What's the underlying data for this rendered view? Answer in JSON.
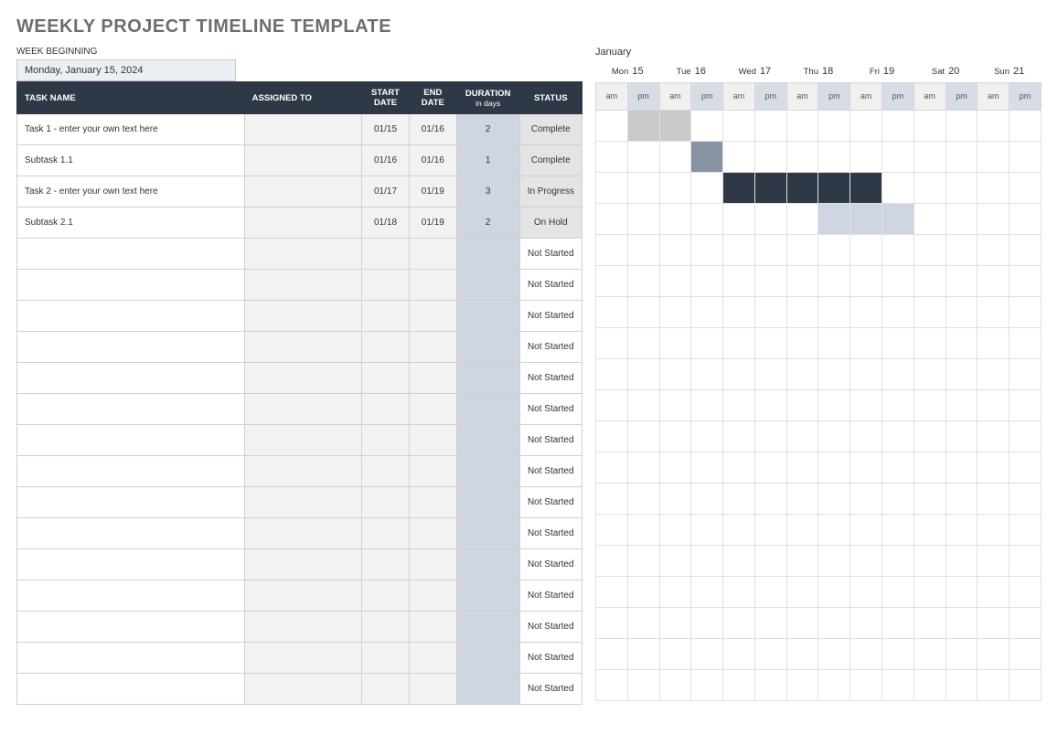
{
  "title": "WEEKLY PROJECT TIMELINE TEMPLATE",
  "week_beginning_label": "WEEK BEGINNING",
  "week_beginning_value": "Monday, January 15, 2024",
  "month": "January",
  "days": [
    {
      "name": "Mon",
      "num": "15"
    },
    {
      "name": "Tue",
      "num": "16"
    },
    {
      "name": "Wed",
      "num": "17"
    },
    {
      "name": "Thu",
      "num": "18"
    },
    {
      "name": "Fri",
      "num": "19"
    },
    {
      "name": "Sat",
      "num": "20"
    },
    {
      "name": "Sun",
      "num": "21"
    }
  ],
  "ampm": {
    "am": "am",
    "pm": "pm"
  },
  "headers": {
    "task": "TASK NAME",
    "assigned": "ASSIGNED TO",
    "start": "START DATE",
    "end": "END DATE",
    "duration": "DURATION",
    "duration_sub": "in days",
    "status": "STATUS"
  },
  "rows": [
    {
      "task": "Task 1 - enter your own text here",
      "assigned": "",
      "start": "01/15",
      "end": "01/16",
      "dur": "2",
      "status": "Complete",
      "status_white": false,
      "bars": [
        {
          "from": 1,
          "to": 2,
          "cls": "bar-grey"
        }
      ]
    },
    {
      "task": "Subtask 1.1",
      "assigned": "",
      "start": "01/16",
      "end": "01/16",
      "dur": "1",
      "status": "Complete",
      "status_white": false,
      "bars": [
        {
          "from": 3,
          "to": 3,
          "cls": "bar-slate"
        }
      ]
    },
    {
      "task": "Task 2 - enter your own text here",
      "assigned": "",
      "start": "01/17",
      "end": "01/19",
      "dur": "3",
      "status": "In Progress",
      "status_white": false,
      "bars": [
        {
          "from": 4,
          "to": 8,
          "cls": "bar-dark"
        }
      ]
    },
    {
      "task": "Subtask 2.1",
      "assigned": "",
      "start": "01/18",
      "end": "01/19",
      "dur": "2",
      "status": "On Hold",
      "status_white": false,
      "bars": [
        {
          "from": 7,
          "to": 9,
          "cls": "bar-light"
        }
      ]
    },
    {
      "task": "",
      "assigned": "",
      "start": "",
      "end": "",
      "dur": "",
      "status": "Not Started",
      "status_white": true,
      "bars": []
    },
    {
      "task": "",
      "assigned": "",
      "start": "",
      "end": "",
      "dur": "",
      "status": "Not Started",
      "status_white": true,
      "bars": []
    },
    {
      "task": "",
      "assigned": "",
      "start": "",
      "end": "",
      "dur": "",
      "status": "Not Started",
      "status_white": true,
      "bars": []
    },
    {
      "task": "",
      "assigned": "",
      "start": "",
      "end": "",
      "dur": "",
      "status": "Not Started",
      "status_white": true,
      "bars": []
    },
    {
      "task": "",
      "assigned": "",
      "start": "",
      "end": "",
      "dur": "",
      "status": "Not Started",
      "status_white": true,
      "bars": []
    },
    {
      "task": "",
      "assigned": "",
      "start": "",
      "end": "",
      "dur": "",
      "status": "Not Started",
      "status_white": true,
      "bars": []
    },
    {
      "task": "",
      "assigned": "",
      "start": "",
      "end": "",
      "dur": "",
      "status": "Not Started",
      "status_white": true,
      "bars": []
    },
    {
      "task": "",
      "assigned": "",
      "start": "",
      "end": "",
      "dur": "",
      "status": "Not Started",
      "status_white": true,
      "bars": []
    },
    {
      "task": "",
      "assigned": "",
      "start": "",
      "end": "",
      "dur": "",
      "status": "Not Started",
      "status_white": true,
      "bars": []
    },
    {
      "task": "",
      "assigned": "",
      "start": "",
      "end": "",
      "dur": "",
      "status": "Not Started",
      "status_white": true,
      "bars": []
    },
    {
      "task": "",
      "assigned": "",
      "start": "",
      "end": "",
      "dur": "",
      "status": "Not Started",
      "status_white": true,
      "bars": []
    },
    {
      "task": "",
      "assigned": "",
      "start": "",
      "end": "",
      "dur": "",
      "status": "Not Started",
      "status_white": true,
      "bars": []
    },
    {
      "task": "",
      "assigned": "",
      "start": "",
      "end": "",
      "dur": "",
      "status": "Not Started",
      "status_white": true,
      "bars": []
    },
    {
      "task": "",
      "assigned": "",
      "start": "",
      "end": "",
      "dur": "",
      "status": "Not Started",
      "status_white": true,
      "bars": []
    },
    {
      "task": "",
      "assigned": "",
      "start": "",
      "end": "",
      "dur": "",
      "status": "Not Started",
      "status_white": true,
      "bars": []
    }
  ]
}
